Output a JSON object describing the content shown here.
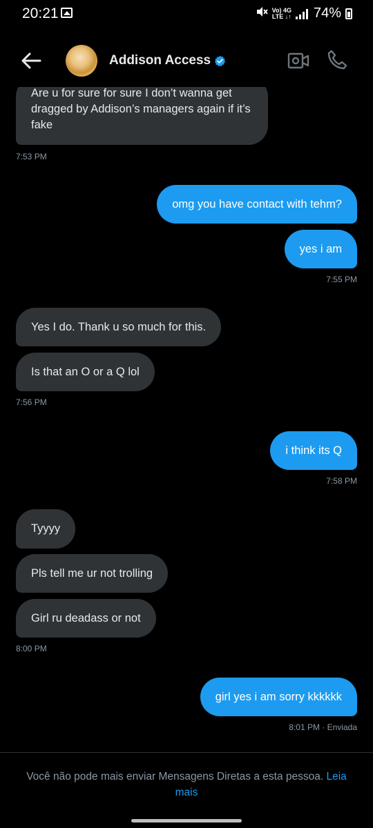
{
  "status_bar": {
    "time": "20:21",
    "network_top": "Vo) 4G",
    "network_bottom": "LTE ↓↑",
    "battery": "74%"
  },
  "header": {
    "contact_name": "Addison Access",
    "verified": true,
    "accent_color": "#1d9bf0"
  },
  "messages": [
    {
      "dir": "in",
      "text": "Are u for sure for sure I don’t wanna get dragged by Addison’s managers again if it’s fake"
    },
    {
      "dir": "meta",
      "text": "7:53 PM"
    },
    {
      "dir": "out",
      "text": "omg you have contact with tehm?"
    },
    {
      "dir": "out",
      "text": "yes i am"
    },
    {
      "dir": "meta",
      "text": "7:55 PM"
    },
    {
      "dir": "in",
      "text": "Yes I do. Thank u so much for this."
    },
    {
      "dir": "in",
      "text": "Is that an O or a Q lol"
    },
    {
      "dir": "meta",
      "text": "7:56 PM"
    },
    {
      "dir": "out",
      "text": "i think its Q"
    },
    {
      "dir": "meta",
      "text": "7:58 PM"
    },
    {
      "dir": "in",
      "text": "Tyyyy"
    },
    {
      "dir": "in",
      "text": "Pls tell me ur not trolling"
    },
    {
      "dir": "in",
      "text": "Girl ru deadass or not"
    },
    {
      "dir": "meta",
      "text": "8:00 PM"
    },
    {
      "dir": "out",
      "text": "girl yes i am sorry kkkkkk"
    },
    {
      "dir": "meta",
      "text": "8:01 PM · Enviada"
    }
  ],
  "footer": {
    "notice": "Você não pode mais enviar Mensagens Diretas a esta pessoa.",
    "link": "Leia mais"
  }
}
